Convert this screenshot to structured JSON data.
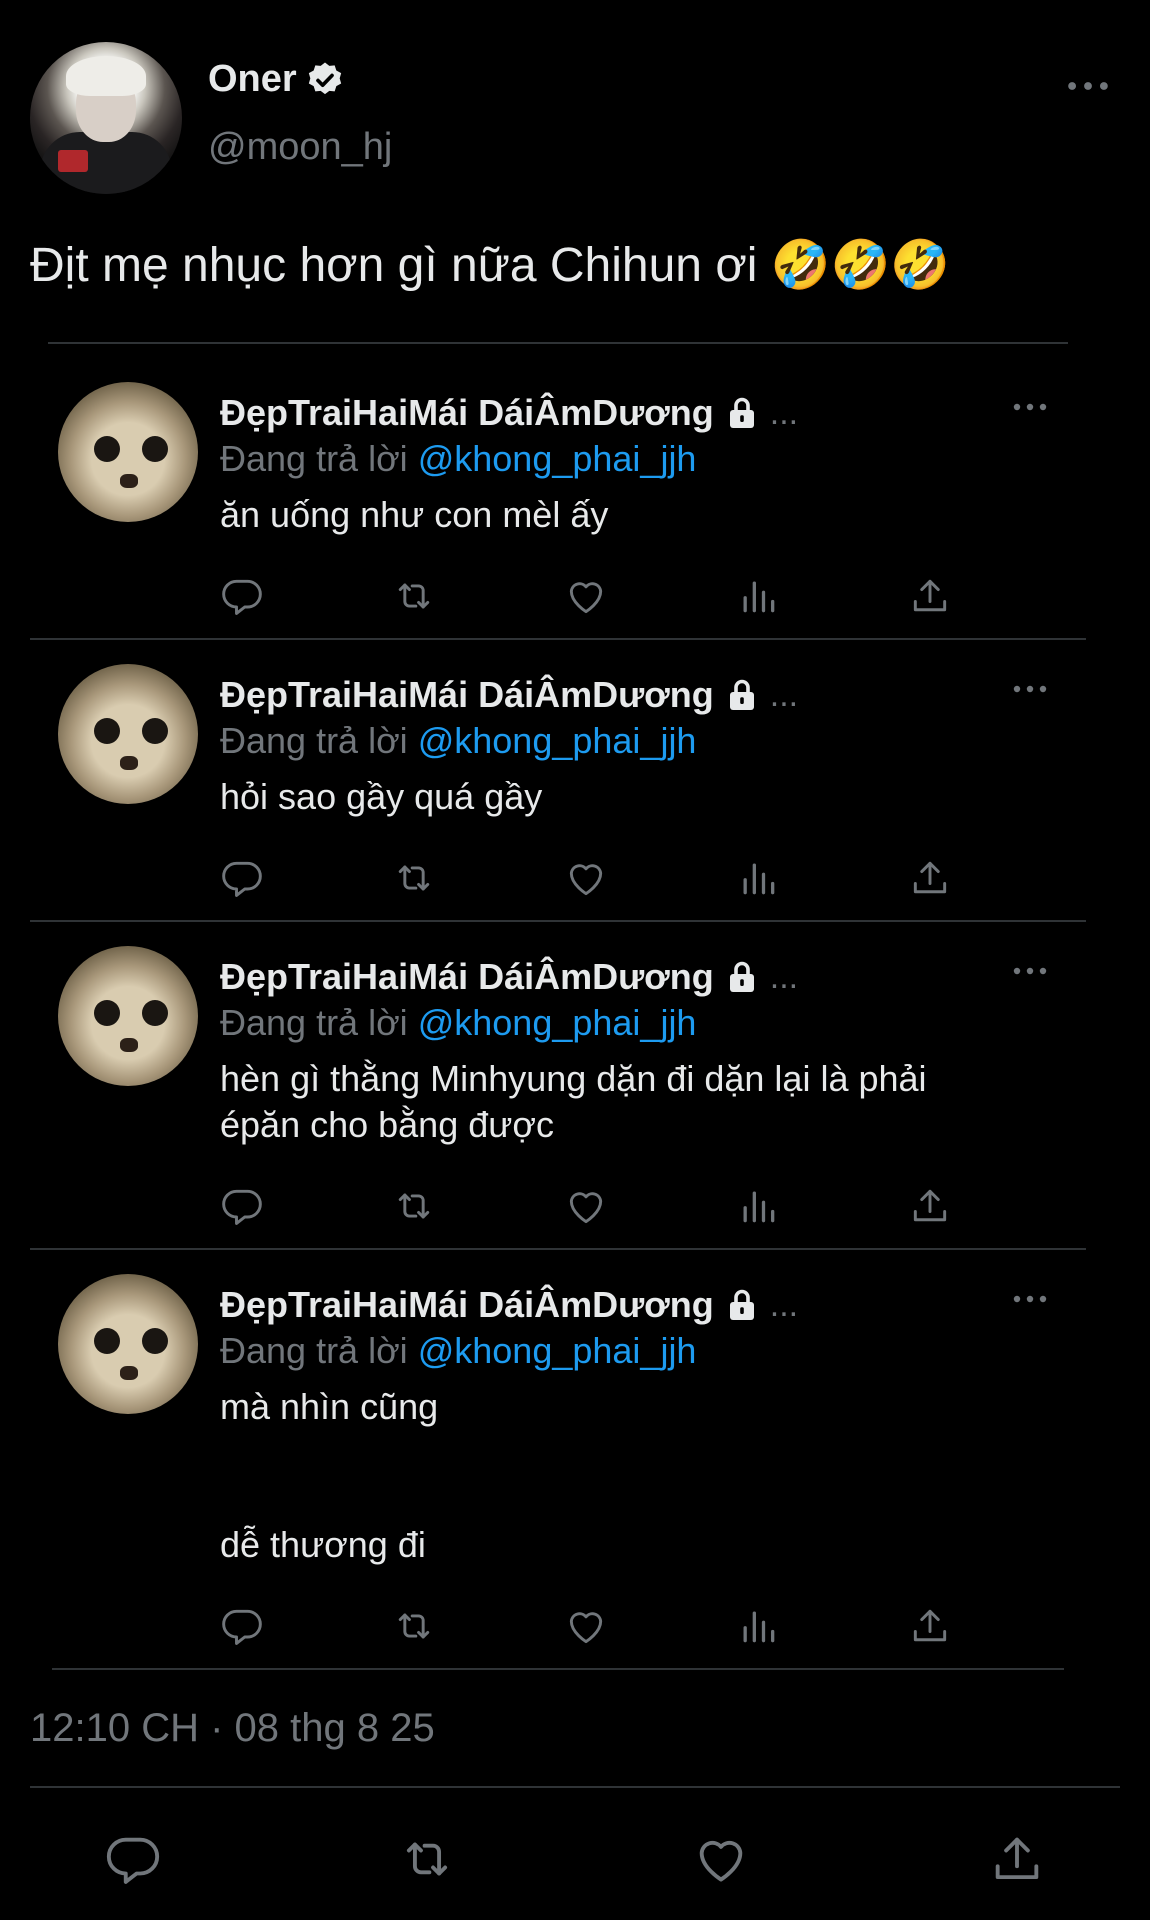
{
  "tweet": {
    "author_name": "Oner",
    "handle": "@moon_hj",
    "text": "Địt mẹ nhục hơn gì nữa Chihun ơi 🤣🤣🤣",
    "timestamp": "12:10 CH · 08 thg 8 25"
  },
  "replies": [
    {
      "name": "ĐẹpTraiHaiMái DáiÂmDương",
      "ellipsis": "...",
      "replying_label": "Đang trả lời",
      "mention": "@khong_phai_jjh",
      "text": "ăn uống như con mèl ấy"
    },
    {
      "name": "ĐẹpTraiHaiMái DáiÂmDương",
      "ellipsis": "...",
      "replying_label": "Đang trả lời",
      "mention": "@khong_phai_jjh",
      "text": "hỏi sao gầy quá gầy"
    },
    {
      "name": "ĐẹpTraiHaiMái DáiÂmDương",
      "ellipsis": "...",
      "replying_label": "Đang trả lời",
      "mention": "@khong_phai_jjh",
      "text": "hèn gì thằng Minhyung dặn đi dặn lại là phải\népăn cho bằng được"
    },
    {
      "name": "ĐẹpTraiHaiMái DáiÂmDương",
      "ellipsis": "...",
      "replying_label": "Đang trả lời",
      "mention": "@khong_phai_jjh",
      "text": "mà nhìn cũng\n\n\ndễ thương đi"
    }
  ],
  "icons": {
    "verified": "verified-badge-icon",
    "lock": "lock-icon",
    "more": "more-icon",
    "reply": "reply-icon",
    "retweet": "retweet-icon",
    "like": "heart-icon",
    "views": "views-icon",
    "share": "share-icon"
  },
  "colors": {
    "background": "#000000",
    "text": "#e7e9ea",
    "secondary": "#71767b",
    "link": "#1d9bf0",
    "divider": "#2f3336"
  }
}
